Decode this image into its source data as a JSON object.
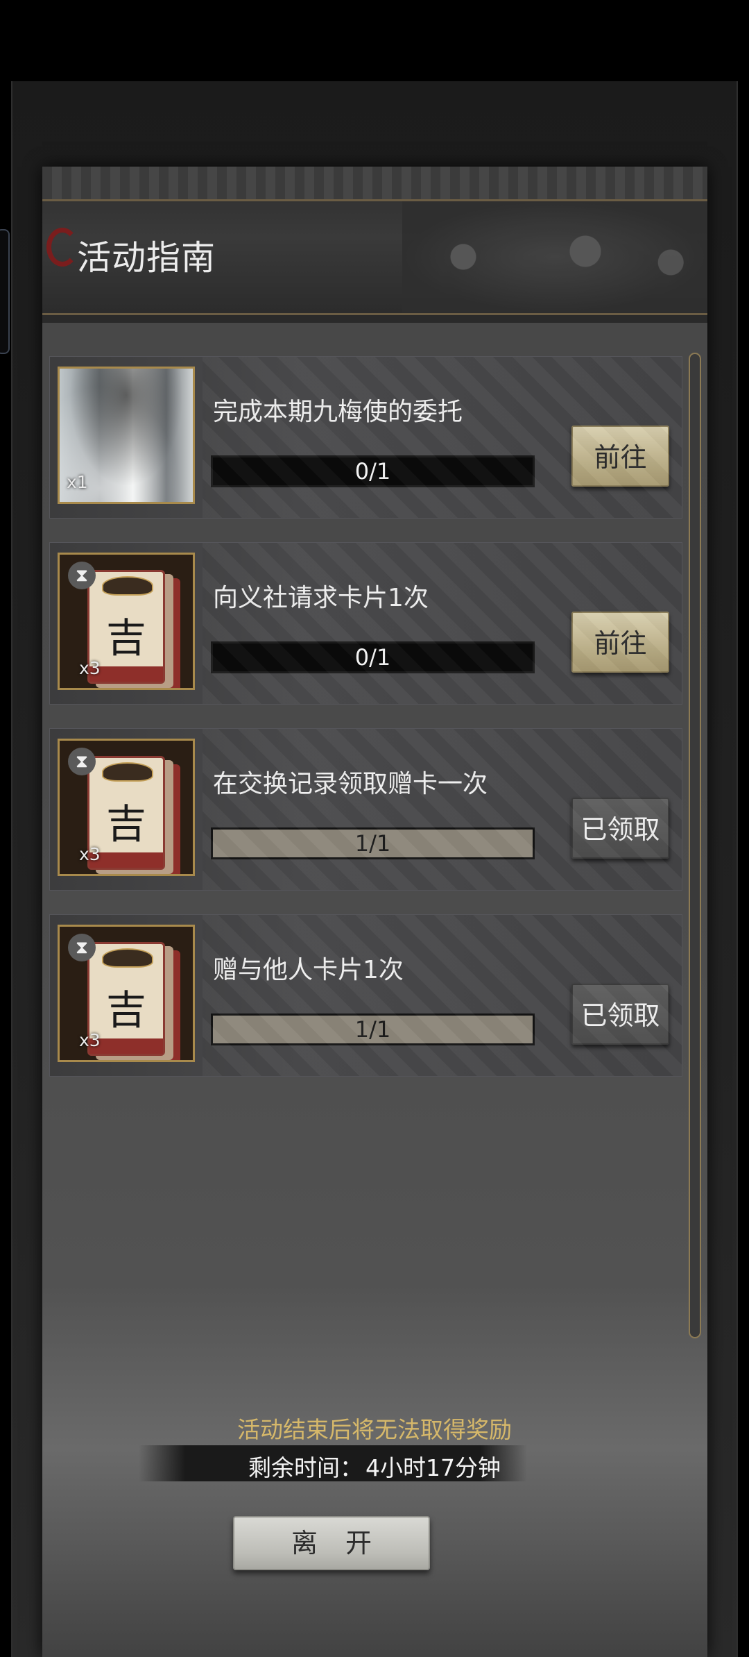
{
  "dialog": {
    "title": "活动指南"
  },
  "tasks": [
    {
      "label": "完成本期九梅使的委托",
      "progress_text": "0/1",
      "progress": 0,
      "qty": "x1",
      "button": "前往",
      "state": "go",
      "reward": "mist-scroll",
      "timed": false
    },
    {
      "label": "向义社请求卡片1次",
      "progress_text": "0/1",
      "progress": 0,
      "qty": "x3",
      "button": "前往",
      "state": "go",
      "reward": "fortune-card",
      "card_char": "吉",
      "timed": true
    },
    {
      "label": "在交换记录领取赠卡一次",
      "progress_text": "1/1",
      "progress": 1,
      "qty": "x3",
      "button": "已领取",
      "state": "claimed",
      "reward": "fortune-card",
      "card_char": "吉",
      "timed": true
    },
    {
      "label": "赠与他人卡片1次",
      "progress_text": "1/1",
      "progress": 1,
      "qty": "x3",
      "button": "已领取",
      "state": "claimed",
      "reward": "fortune-card",
      "card_char": "吉",
      "timed": true
    }
  ],
  "footer": {
    "note": "活动结束后将无法取得奖励",
    "timer_label": "剩余时间：",
    "timer_value": "4小时17分钟",
    "leave_button": "离开"
  },
  "colors": {
    "note": "#d6b86a",
    "go_button": "#c9be98",
    "claimed_button": "#555555",
    "frame_gold": "#a88a4c"
  },
  "icons": {
    "hourglass": "hourglass-icon"
  }
}
